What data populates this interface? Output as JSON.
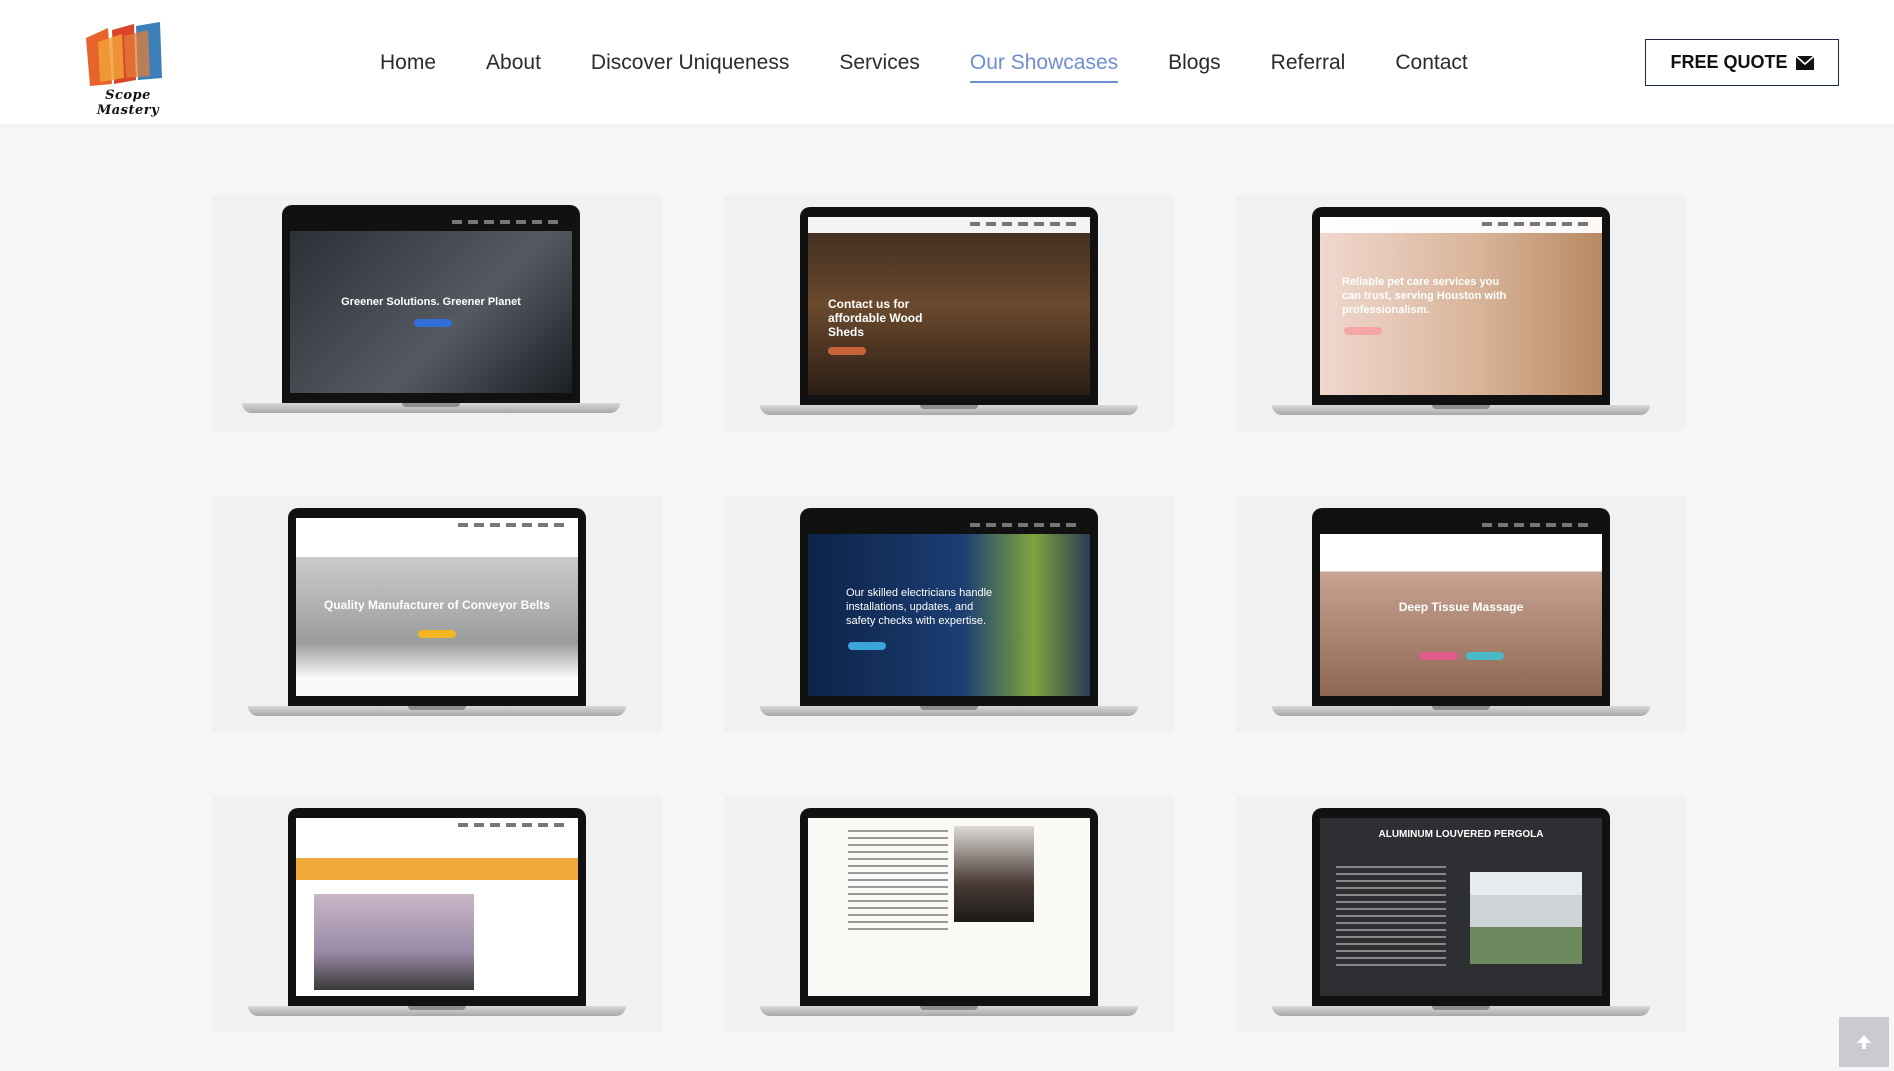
{
  "brand": {
    "name": "Scope Mastery"
  },
  "nav": {
    "items": [
      {
        "label": "Home"
      },
      {
        "label": "About"
      },
      {
        "label": "Discover Uniqueness"
      },
      {
        "label": "Services"
      },
      {
        "label": "Our Showcases",
        "active": true
      },
      {
        "label": "Blogs"
      },
      {
        "label": "Referral"
      },
      {
        "label": "Contact"
      }
    ],
    "cta": "FREE QUOTE"
  },
  "showcases": [
    {
      "headline": "Greener Solutions. Greener Planet"
    },
    {
      "headline": "Contact us for affordable Wood Sheds"
    },
    {
      "headline": "Reliable pet care services you can trust, serving Houston with professionalism."
    },
    {
      "headline": "Quality Manufacturer of Conveyor Belts"
    },
    {
      "headline": "Our skilled electricians handle installations, updates, and safety checks with expertise."
    },
    {
      "headline": "Deep Tissue Massage"
    },
    {
      "headline": ""
    },
    {
      "headline": ""
    },
    {
      "headline": "ALUMINUM LOUVERED PERGOLA"
    }
  ],
  "colors": {
    "accent": "#6f8dd0",
    "cta_border": "#1e2a44"
  }
}
